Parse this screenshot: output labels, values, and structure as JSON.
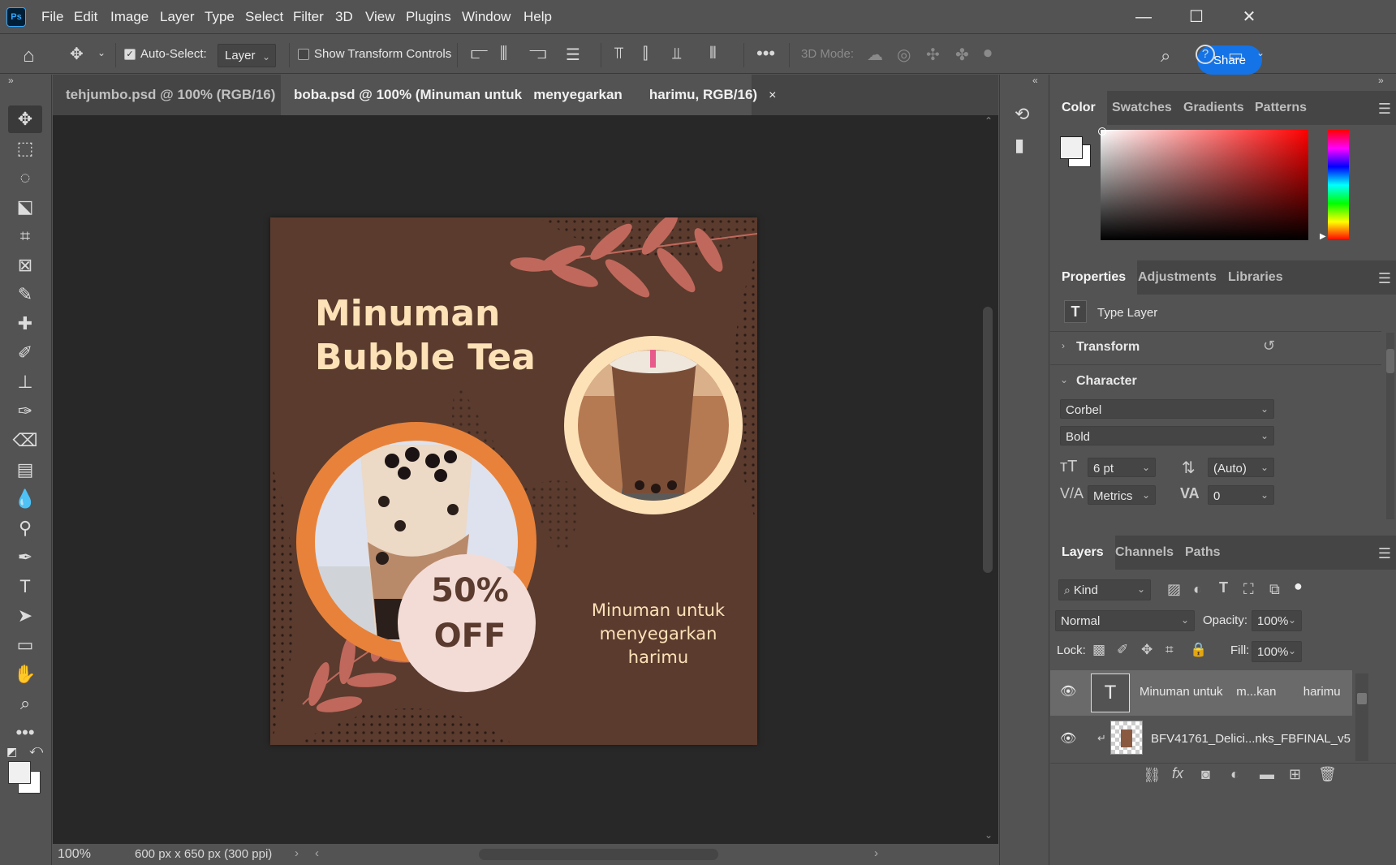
{
  "app": {
    "logo": "Ps"
  },
  "menu": [
    "File",
    "Edit",
    "Image",
    "Layer",
    "Type",
    "Select",
    "Filter",
    "3D",
    "View",
    "Plugins",
    "Window",
    "Help"
  ],
  "window_controls": {
    "minimize": "—",
    "maximize": "☐",
    "close": "✕"
  },
  "options": {
    "auto_select_label": "Auto-Select:",
    "auto_select_value": "Layer",
    "show_transform_label": "Show Transform Controls",
    "mode_3d_label": "3D Mode:",
    "share_label": "Share"
  },
  "tabs": [
    {
      "label": "tehjumbo.psd @ 100% (RGB/16)",
      "close": "×"
    },
    {
      "label": "boba.psd @ 100% (Minuman untuk   menyegarkan       harimu, RGB/16)",
      "close": "×"
    }
  ],
  "design": {
    "title_line1": "Minuman",
    "title_line2": "Bubble Tea",
    "discount_line1": "50%",
    "discount_line2": "OFF",
    "tagline_line1": "Minuman untuk",
    "tagline_line2": "menyegarkan",
    "tagline_line3": "harimu",
    "colors": {
      "background": "#5a3b2e",
      "accent_orange": "#e8823a",
      "cream": "#fde2b8",
      "leaf": "#c0685c",
      "discount_circle": "#f3dcd6"
    }
  },
  "status": {
    "zoom": "100%",
    "doc_info": "600 px x 650 px (300 ppi)"
  },
  "color_panel": {
    "tabs": [
      "Color",
      "Swatches",
      "Gradients",
      "Patterns"
    ],
    "active": "Color",
    "foreground": "#f0f0f0",
    "background_color": "#ffffff"
  },
  "properties_panel": {
    "tabs": [
      "Properties",
      "Adjustments",
      "Libraries"
    ],
    "layer_type": "Type Layer",
    "transform_label": "Transform",
    "character_label": "Character",
    "font_family": "Corbel",
    "font_style": "Bold",
    "font_size": "6 pt",
    "leading": "(Auto)",
    "kerning": "Metrics",
    "tracking": "0"
  },
  "layers_panel": {
    "tabs": [
      "Layers",
      "Channels",
      "Paths"
    ],
    "filter_kind": "Kind",
    "blend_mode": "Normal",
    "opacity_label": "Opacity:",
    "opacity": "100%",
    "lock_label": "Lock:",
    "fill_label": "Fill:",
    "fill": "100%",
    "layers": [
      {
        "name": "Minuman untuk    m...kan        harimu",
        "type": "text",
        "visible": true,
        "selected": true
      },
      {
        "name": "BFV41761_Delici...nks_FBFINAL_v5",
        "type": "image",
        "visible": true,
        "selected": false
      }
    ]
  }
}
